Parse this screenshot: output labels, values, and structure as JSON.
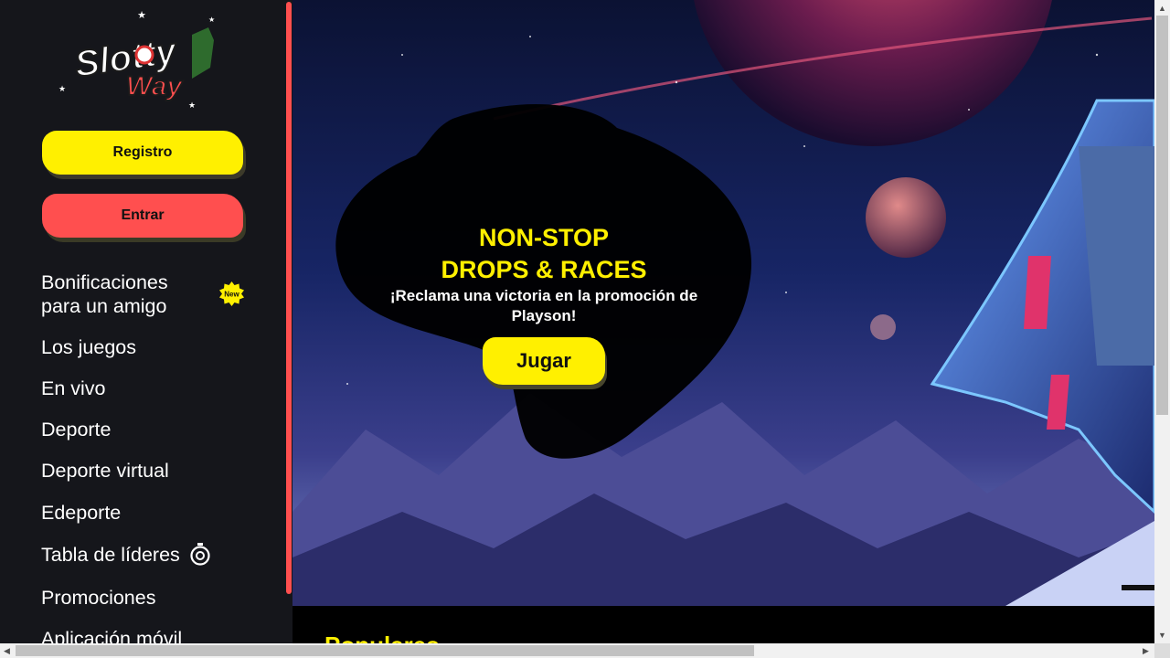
{
  "brand": {
    "line1": "Slotty",
    "line2": "Way"
  },
  "sidebar": {
    "register_label": "Registro",
    "login_label": "Entrar",
    "nav": [
      {
        "label": "Bonificaciones"
      },
      {
        "label": "para un amigo"
      },
      {
        "label": "Los juegos"
      },
      {
        "label": "En vivo"
      },
      {
        "label": "Deporte"
      },
      {
        "label": "Deporte virtual"
      },
      {
        "label": "Edeporte"
      },
      {
        "label": "Tabla de líderes"
      },
      {
        "label": "Promociones"
      },
      {
        "label": "Aplicación móvil"
      }
    ],
    "new_badge": "New",
    "leaderboard_icon": "stopwatch-icon"
  },
  "banner": {
    "title_line1": "NON-STOP",
    "title_line2": "DROPS & RACES",
    "subtitle": "¡Reclama una victoria en la promoción de Playson!",
    "play_label": "Jugar"
  },
  "section": {
    "title": "Populares"
  },
  "colors": {
    "accent_yellow": "#fff000",
    "accent_red": "#ff4f4f",
    "sidebar_bg": "#15161b"
  }
}
